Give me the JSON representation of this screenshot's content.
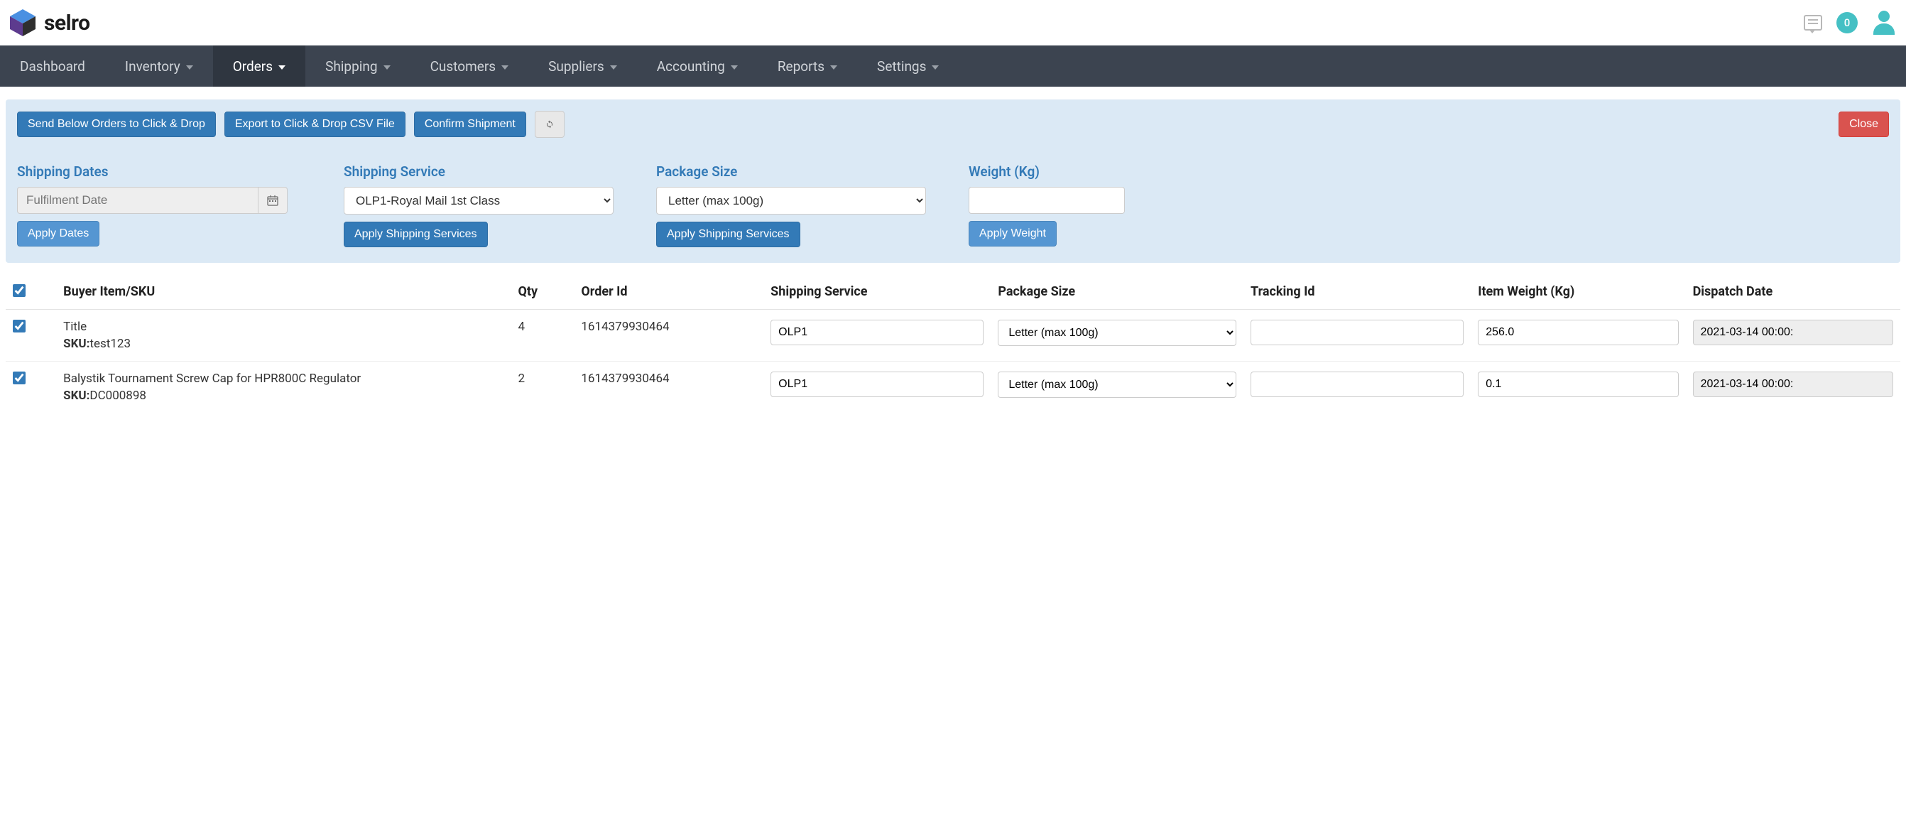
{
  "brand": {
    "name": "selro"
  },
  "header": {
    "notification_count": "0"
  },
  "nav": {
    "items": [
      {
        "label": "Dashboard",
        "dropdown": false,
        "active": false
      },
      {
        "label": "Inventory",
        "dropdown": true,
        "active": false
      },
      {
        "label": "Orders",
        "dropdown": true,
        "active": true
      },
      {
        "label": "Shipping",
        "dropdown": true,
        "active": false
      },
      {
        "label": "Customers",
        "dropdown": true,
        "active": false
      },
      {
        "label": "Suppliers",
        "dropdown": true,
        "active": false
      },
      {
        "label": "Accounting",
        "dropdown": true,
        "active": false
      },
      {
        "label": "Reports",
        "dropdown": true,
        "active": false
      },
      {
        "label": "Settings",
        "dropdown": true,
        "active": false
      }
    ]
  },
  "toolbar": {
    "send_label": "Send Below Orders to Click & Drop",
    "export_label": "Export to Click & Drop CSV File",
    "confirm_label": "Confirm Shipment",
    "close_label": "Close"
  },
  "filters": {
    "dates": {
      "label": "Shipping Dates",
      "placeholder": "Fulfilment Date",
      "apply_label": "Apply Dates"
    },
    "service": {
      "label": "Shipping Service",
      "selected": "OLP1-Royal Mail 1st Class",
      "apply_label": "Apply Shipping Services"
    },
    "package": {
      "label": "Package Size",
      "selected": "Letter (max 100g)",
      "apply_label": "Apply Shipping Services"
    },
    "weight": {
      "label": "Weight (Kg)",
      "value": "",
      "apply_label": "Apply Weight"
    }
  },
  "table": {
    "headers": {
      "item": "Buyer Item/SKU",
      "qty": "Qty",
      "order": "Order Id",
      "service": "Shipping Service",
      "package": "Package Size",
      "tracking": "Tracking Id",
      "weight": "Item Weight (Kg)",
      "dispatch": "Dispatch Date"
    },
    "sku_prefix": "SKU:",
    "rows": [
      {
        "checked": true,
        "title": "Title",
        "sku": "test123",
        "qty": "4",
        "order_id": "1614379930464",
        "service": "OLP1",
        "package": "Letter (max 100g)",
        "tracking": "",
        "weight": "256.0",
        "dispatch": "2021-03-14 00:00:"
      },
      {
        "checked": true,
        "title": "Balystik Tournament Screw Cap for HPR800C Regulator",
        "sku": "DC000898",
        "qty": "2",
        "order_id": "1614379930464",
        "service": "OLP1",
        "package": "Letter (max 100g)",
        "tracking": "",
        "weight": "0.1",
        "dispatch": "2021-03-14 00:00:"
      }
    ]
  }
}
